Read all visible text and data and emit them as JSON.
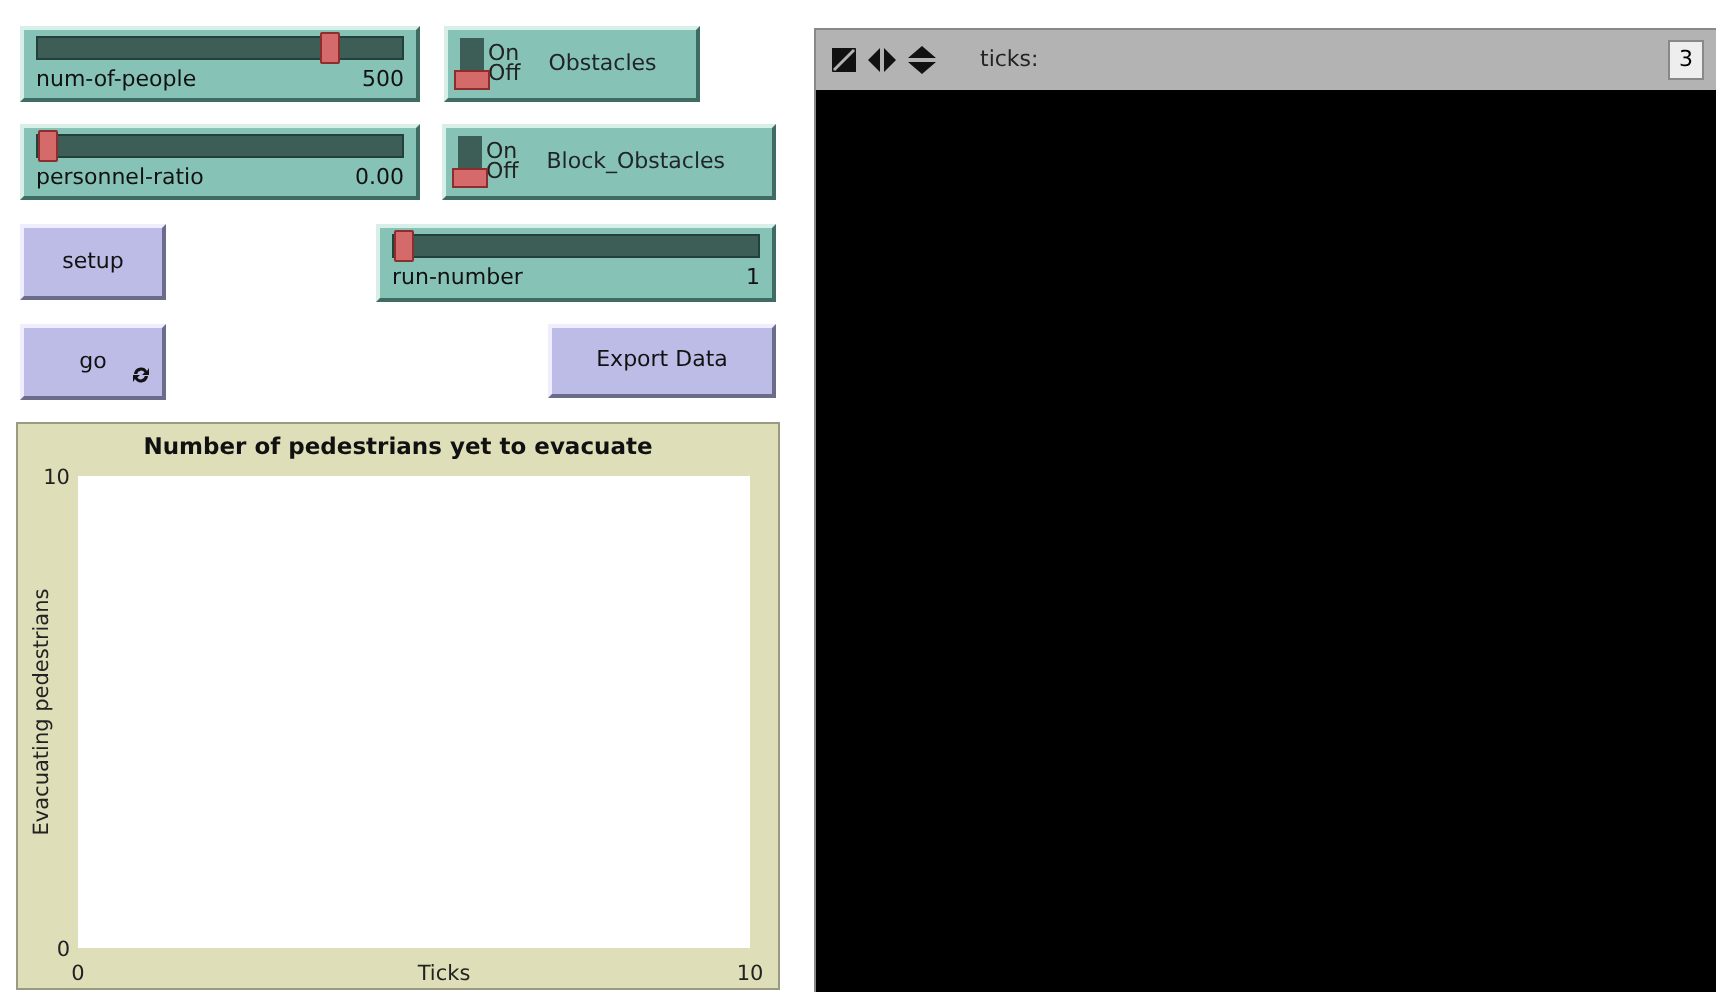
{
  "widgets": [
    {
      "kind": "slider",
      "label": "num-of-people",
      "value": "500",
      "level": 0.82
    },
    {
      "kind": "switch",
      "label": "Obstacles",
      "on_label": "On",
      "off_label": "Off",
      "on": false
    },
    {
      "kind": "slider",
      "label": "personnel-ratio",
      "value": "0.00",
      "level": 0
    },
    {
      "kind": "switch",
      "label": "Block_Obstacles",
      "on_label": "On",
      "off_label": "Off",
      "on": false
    },
    {
      "kind": "button",
      "label": "setup",
      "forever": false
    },
    {
      "kind": "slider",
      "label": "run-number",
      "value": "1",
      "level": 0
    },
    {
      "kind": "button",
      "label": "go",
      "forever": true
    },
    {
      "kind": "button",
      "label": "Export Data",
      "forever": false
    }
  ],
  "plot": {
    "chart_data": {
      "type": "line",
      "title": "Number of pedestrians yet to evacuate",
      "xlabel": "Ticks",
      "ylabel": "Evacuating pedestrians",
      "xlim": [
        0,
        10
      ],
      "ylim": [
        0,
        10
      ],
      "xticks": [
        0,
        10
      ],
      "yticks": [
        0,
        10
      ]
    }
  },
  "view": {
    "ticks_label": "ticks:",
    "button_3d": "3"
  }
}
